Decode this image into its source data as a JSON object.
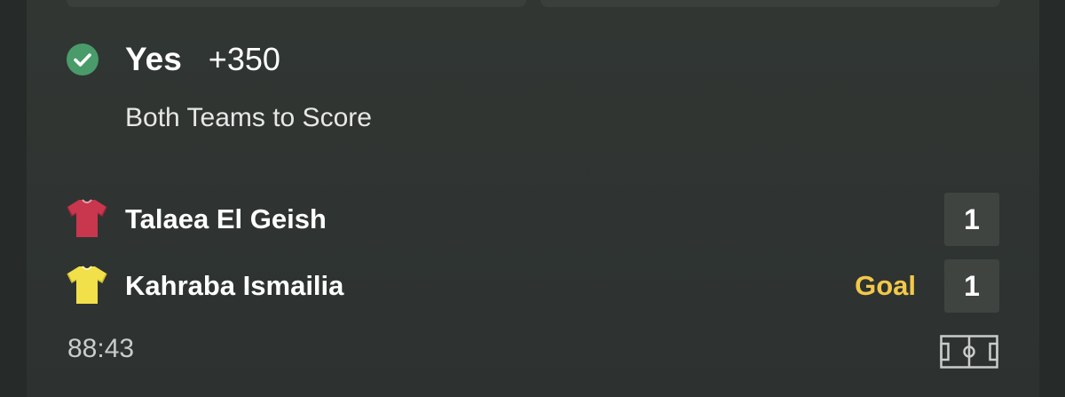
{
  "bet": {
    "status_icon": "check-circle-icon",
    "status_color": "#4a9b6a",
    "selection": "Yes",
    "odds": "+350",
    "market": "Both Teams to Score"
  },
  "match": {
    "teams": [
      {
        "name": "Talaea El Geish",
        "jersey_icon": "red-jersey-icon",
        "jersey_color": "#c8374d",
        "event": "",
        "score": "1"
      },
      {
        "name": "Kahraba Ismailia",
        "jersey_icon": "yellow-jersey-icon",
        "jersey_color": "#f1e04a",
        "event": "Goal",
        "event_color": "#f2c84b",
        "score": "1"
      }
    ],
    "time": "88:43",
    "pitch_icon": "pitch-icon"
  }
}
